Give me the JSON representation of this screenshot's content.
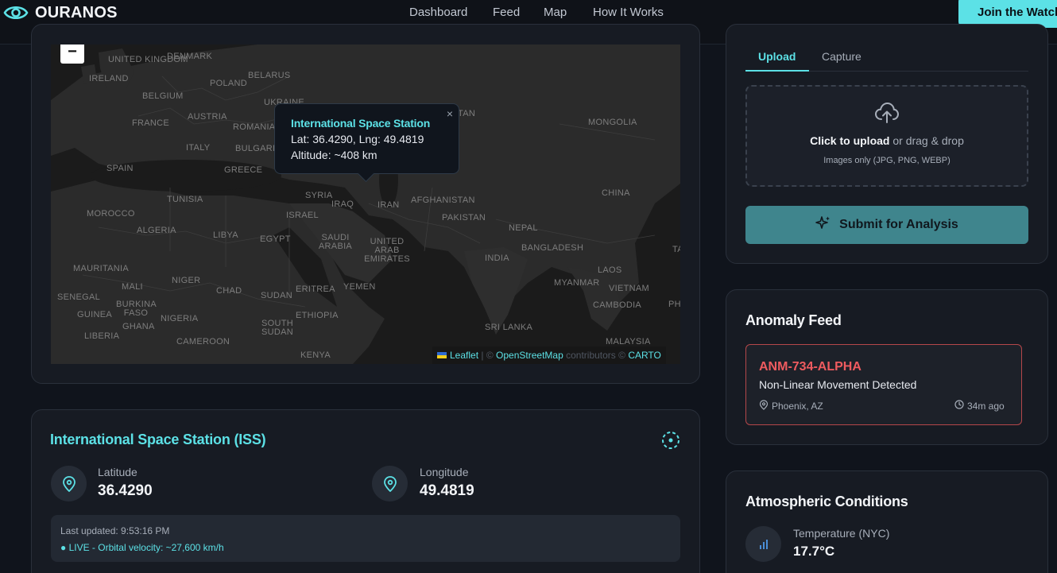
{
  "brand": {
    "name": "OURANOS"
  },
  "nav": {
    "links": [
      "Dashboard",
      "Feed",
      "Map",
      "How It Works"
    ],
    "cta": "Join the Watch"
  },
  "map": {
    "zoom_out": "−",
    "labels": [
      "UNITED KINGDOM",
      "IRELAND",
      "DENMARK",
      "BELARUS",
      "POLAND",
      "UKRAINE",
      "BELGIUM",
      "FRANCE",
      "AUSTRIA",
      "ROMANIA",
      "ITALY",
      "BULGARIA",
      "SPAIN",
      "GREECE",
      "TAN",
      "MONGOLIA",
      "CHINA",
      "SYRIA",
      "IRAQ",
      "IRAN",
      "AFGHANISTAN",
      "PAKISTAN",
      "TUNISIA",
      "MOROCCO",
      "ALGERIA",
      "LIBYA",
      "ISRAEL",
      "EGYPT",
      "SAUDI ARABIA",
      "UNITED ARAB EMIRATES",
      "NEPAL",
      "BANGLADESH",
      "INDIA",
      "MAURITANIA",
      "MALI",
      "NIGER",
      "CHAD",
      "SUDAN",
      "ERITREA",
      "YEMEN",
      "MYANMAR",
      "LAOS",
      "VIETNAM",
      "SENEGAL",
      "BURKINA FASO",
      "GUINEA",
      "GHANA",
      "NIGERIA",
      "ETHIOPIA",
      "CAMBODIA",
      "PH",
      "LIBERIA",
      "CAMEROON",
      "SOUTH SUDAN",
      "SRI LANKA",
      "MALAYSIA",
      "KENYA",
      "TA"
    ],
    "popup": {
      "title": "International Space Station",
      "lat_lng": "Lat: 36.4290, Lng: 49.4819",
      "altitude": "Altitude: ~408 km",
      "close": "×"
    },
    "attribution": {
      "leaflet": "Leaflet",
      "sep": "|",
      "copy": "©",
      "osm": "OpenStreetMap",
      "contributors": "contributors ©",
      "carto": "CARTO"
    }
  },
  "iss": {
    "title": "International Space Station (ISS)",
    "latitude_label": "Latitude",
    "latitude_value": "36.4290",
    "longitude_label": "Longitude",
    "longitude_value": "49.4819",
    "last_updated": "Last updated: 9:53:16 PM",
    "live": "● LIVE - Orbital velocity: ~27,600 km/h"
  },
  "upload": {
    "tabs": [
      "Upload",
      "Capture"
    ],
    "drop_strong": "Click to upload",
    "drop_rest": " or drag & drop",
    "drop_sub": "Images only (JPG, PNG, WEBP)",
    "submit": "Submit for Analysis"
  },
  "feed": {
    "title": "Anomaly Feed",
    "items": [
      {
        "id": "ANM-734-ALPHA",
        "description": "Non-Linear Movement Detected",
        "location": "Phoenix, AZ",
        "time": "34m ago"
      }
    ]
  },
  "atmosphere": {
    "title": "Atmospheric Conditions",
    "temperature_label": "Temperature (NYC)",
    "temperature_value": "17.7°C"
  },
  "colors": {
    "accent": "#5ce1e6",
    "danger": "#ef5b5f",
    "background": "#10141c",
    "card": "#171b23"
  }
}
